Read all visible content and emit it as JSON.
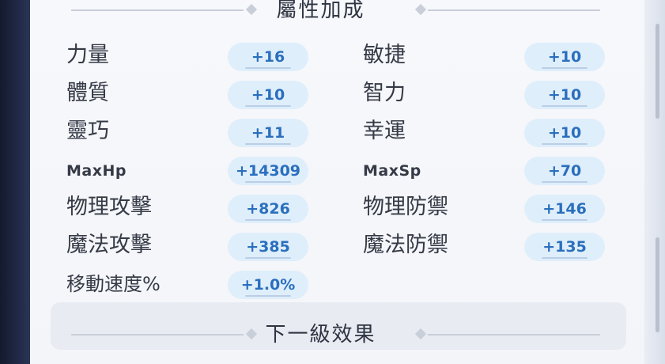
{
  "header": {
    "title": "屬性加成"
  },
  "stats": [
    {
      "label": "力量",
      "value": "+16"
    },
    {
      "label": "敏捷",
      "value": "+10"
    },
    {
      "label": "體質",
      "value": "+10"
    },
    {
      "label": "智力",
      "value": "+10"
    },
    {
      "label": "靈巧",
      "value": "+11"
    },
    {
      "label": "幸運",
      "value": "+10"
    },
    {
      "label": "MaxHp",
      "value": "+14309"
    },
    {
      "label": "MaxSp",
      "value": "+70"
    },
    {
      "label": "物理攻擊",
      "value": "+826"
    },
    {
      "label": "物理防禦",
      "value": "+146"
    },
    {
      "label": "魔法攻擊",
      "value": "+385"
    },
    {
      "label": "魔法防禦",
      "value": "+135"
    },
    {
      "label": "移動速度%",
      "value": "+1.0%"
    }
  ],
  "footer": {
    "title": "下一級效果"
  }
}
